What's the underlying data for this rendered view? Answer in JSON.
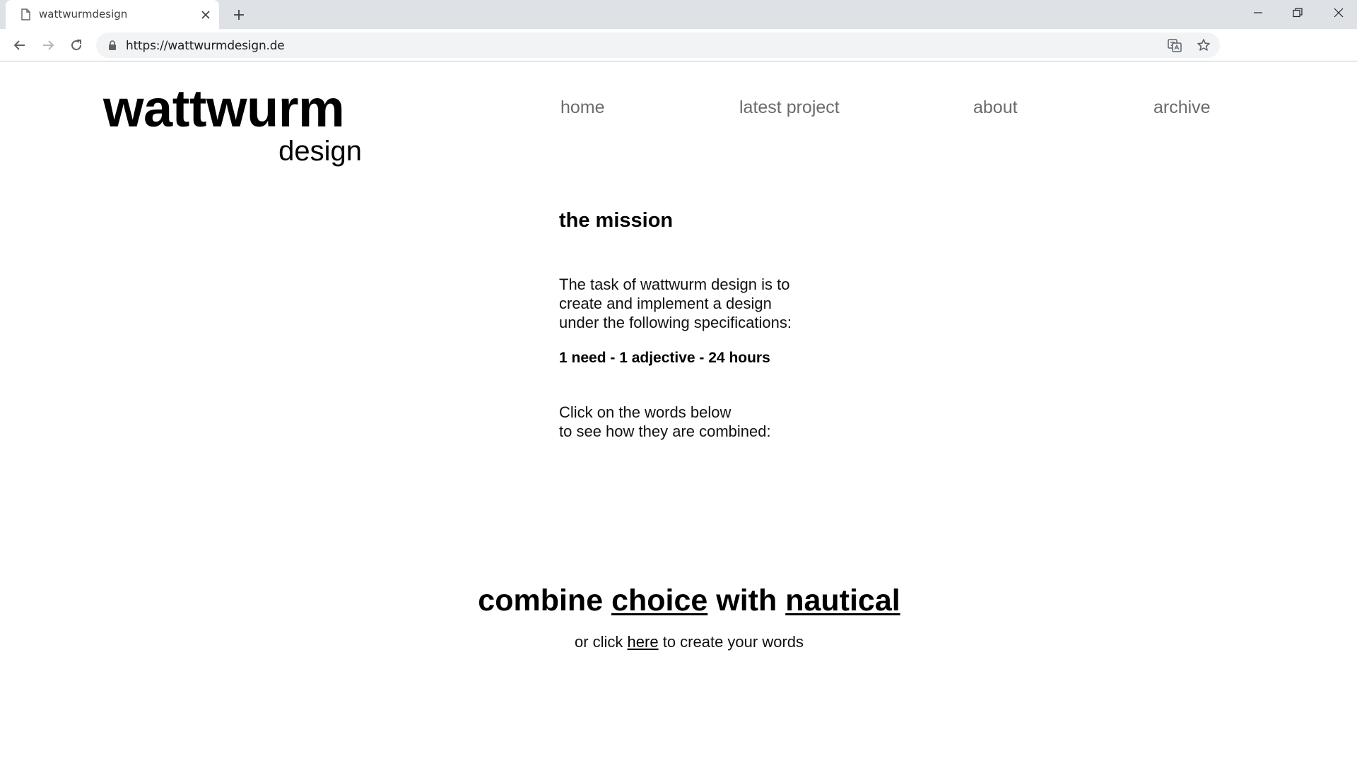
{
  "browser": {
    "tab_title": "wattwurmdesign",
    "url": "https://wattwurmdesign.de"
  },
  "logo": {
    "main": "wattwurm",
    "sub": "design"
  },
  "nav": {
    "home": "home",
    "latest": "latest project",
    "about": "about",
    "archive": "archive"
  },
  "mission": {
    "title": "the mission",
    "para1": [
      "The task of wattwurm design is to",
      "create and implement a design",
      "under the following specifications:"
    ],
    "spec": "1 need - 1 adjective - 24 hours",
    "para2": [
      "Click on the words below",
      "to see how they are combined:"
    ]
  },
  "combine": {
    "prefix": "combine",
    "word1": "choice",
    "middle": "with",
    "word2": "nautical"
  },
  "create": {
    "prefix": "or click",
    "link": "here",
    "suffix": "to create your words"
  },
  "colors": {
    "tabbar": "#dee1e6",
    "omnibox": "#f1f3f4",
    "nav_text": "#6b6b6b"
  }
}
